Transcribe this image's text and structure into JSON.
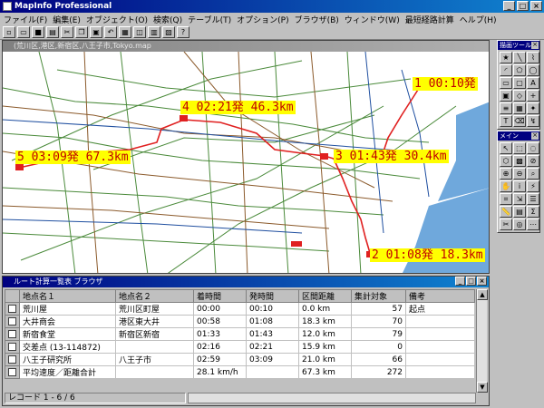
{
  "app": {
    "title": "MapInfo Professional"
  },
  "menu": [
    "ファイル(F)",
    "編集(E)",
    "オブジェクト(O)",
    "検索(Q)",
    "テーブル(T)",
    "オプション(P)",
    "ブラウザ(B)",
    "ウィンドウ(W)",
    "最短経路計算",
    "ヘルプ(H)"
  ],
  "map": {
    "window_title": "(荒川区,港区,新宿区,八王子市,Tokyo.map",
    "labels": [
      "1 00:10発",
      "2 01:08発 18.3km",
      "3 01:43発 30.4km",
      "4 02:21発 46.3km",
      "5 03:09発 67.3km"
    ]
  },
  "palettes": {
    "drawing_title": "描画ツール",
    "main_title": "メイン"
  },
  "browser": {
    "title": "ルート計算一覧表 ブラウザ",
    "columns": [
      "地点名１",
      "地点名２",
      "着時間",
      "発時間",
      "区間距離",
      "集計対象",
      "備考"
    ],
    "rows": [
      [
        "荒川屋",
        "荒川区町屋",
        "00:00",
        "00:10",
        "0.0 km",
        "57",
        "起点"
      ],
      [
        "大井商会",
        "港区東大井",
        "00:58",
        "01:08",
        "18.3 km",
        "70",
        ""
      ],
      [
        "新宿食堂",
        "新宿区新宿",
        "01:33",
        "01:43",
        "12.0 km",
        "79",
        ""
      ],
      [
        "交差点 (13-114872)",
        "",
        "02:16",
        "02:21",
        "15.9 km",
        "0",
        ""
      ],
      [
        "八王子研究所",
        "八王子市",
        "02:59",
        "03:09",
        "21.0 km",
        "66",
        ""
      ],
      [
        "平均速度／距離合計",
        "",
        "28.1 km/h",
        "",
        "67.3 km",
        "272",
        ""
      ]
    ],
    "status": "レコード 1 - 6 / 6"
  }
}
